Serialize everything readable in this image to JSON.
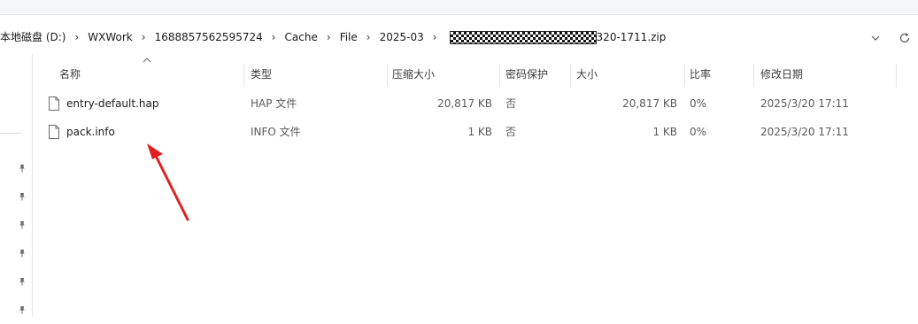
{
  "address": {
    "crumbs": [
      "本地磁盘 (D:)",
      "WXWork",
      "1688857562595724",
      "Cache",
      "File",
      "2025-03"
    ],
    "separator": "›",
    "last_visible": "320-1711.zip",
    "dropdown_icon": "chevron-down-icon",
    "refresh_icon": "refresh-icon"
  },
  "columns": {
    "name": "名称",
    "type": "类型",
    "compressed": "压缩大小",
    "password": "密码保护",
    "size": "大小",
    "ratio": "比率",
    "modified": "修改日期"
  },
  "files": [
    {
      "name": "entry-default.hap",
      "type": "HAP 文件",
      "compressed": "20,817 KB",
      "password": "否",
      "size": "20,817 KB",
      "ratio": "0%",
      "modified": "2025/3/20 17:11"
    },
    {
      "name": "pack.info",
      "type": "INFO 文件",
      "compressed": "1 KB",
      "password": "否",
      "size": "1 KB",
      "ratio": "0%",
      "modified": "2025/3/20 17:11"
    }
  ],
  "annotation": {
    "arrow_color": "#e02020"
  },
  "colors": {
    "accent": "#1a1a1a",
    "header_text": "#3c3c3c",
    "divider": "#e5e5e5"
  }
}
